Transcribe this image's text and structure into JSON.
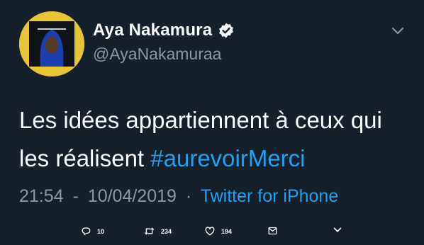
{
  "user": {
    "name": "Aya Nakamura",
    "handle": "@AyaNakamuraa"
  },
  "tweet": {
    "text_line1": "Les idées appartiennent à ceux qui",
    "text_line2_plain": "les réalisent",
    "hashtag": "#aurevoirMerci"
  },
  "meta": {
    "time": "21:54",
    "date": "10/04/2019",
    "separator1": "-",
    "separator2": "·",
    "source": "Twitter for iPhone"
  },
  "actions": {
    "replies": "10",
    "retweets": "234",
    "likes": "194"
  },
  "colors": {
    "background": "#15202b",
    "accent": "#1da1f2",
    "secondary_text": "#8899a6",
    "avatar_bg": "#e8c437"
  },
  "icons": [
    "verified-badge-icon",
    "chevron-down-icon",
    "reply-icon",
    "retweet-icon",
    "like-icon",
    "direct-message-icon",
    "share-chevron-icon"
  ]
}
